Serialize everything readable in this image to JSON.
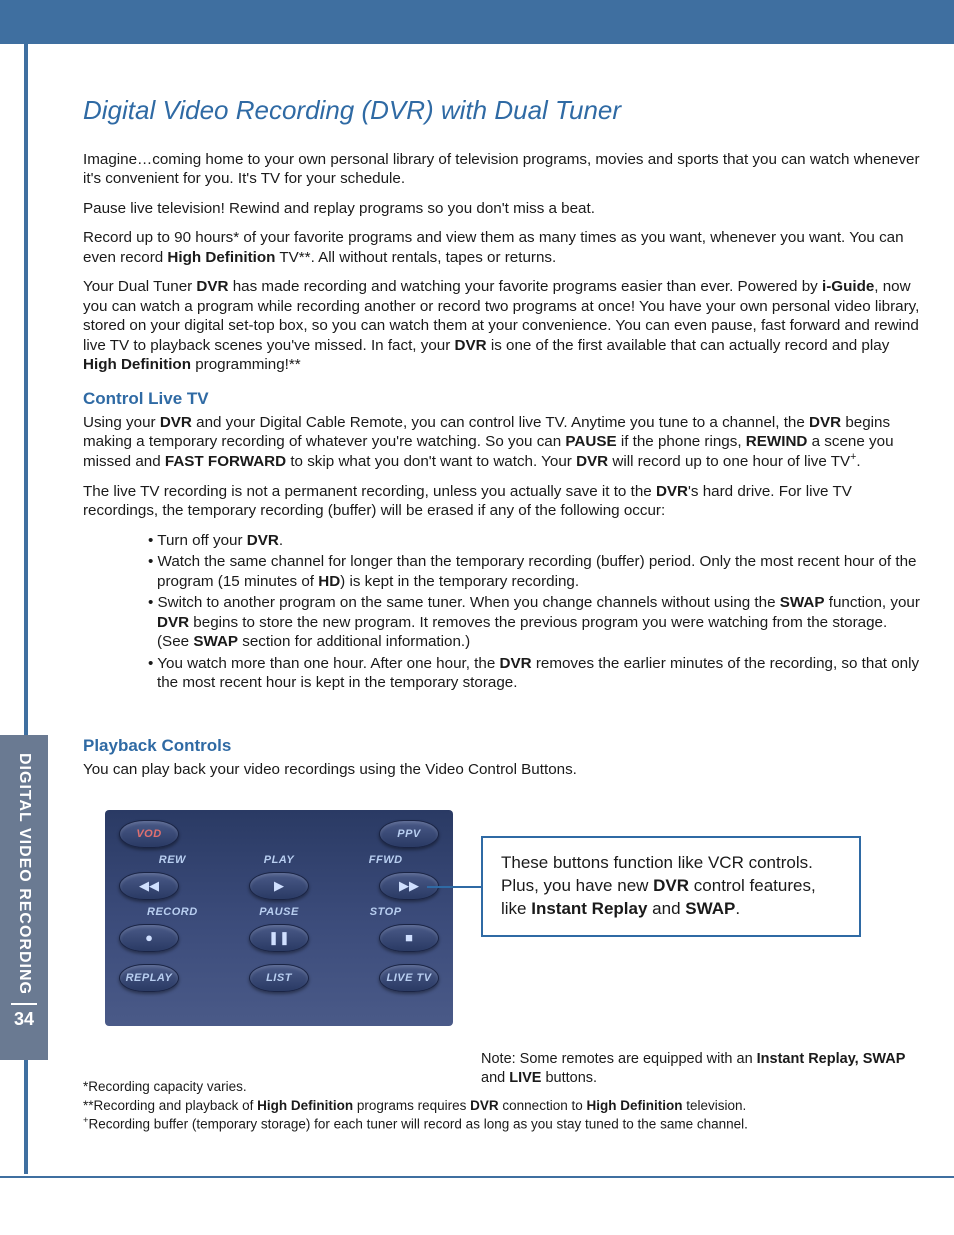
{
  "page": {
    "section_tab": "DIGITAL VIDEO RECORDING",
    "page_number": "34",
    "title": "Digital Video Recording (DVR) with Dual Tuner"
  },
  "intro": {
    "p1": "Imagine…coming home to your own personal library of television programs, movies and sports that you can watch whenever it's convenient for you. It's TV for your schedule.",
    "p2": "Pause live television! Rewind and replay programs so you don't miss a beat.",
    "p3a": "Record up to 90 hours* of your favorite programs and view them as many times as you want, whenever you want. You can even record ",
    "p3b": "High Definition",
    "p3c": " TV**. All without rentals, tapes or returns.",
    "p4a": "Your Dual Tuner ",
    "p4b": "DVR",
    "p4c": " has made recording and watching your favorite programs easier than ever. Powered by ",
    "p4d": "i-Guide",
    "p4e": ", now you can watch a program while recording another or record two programs at once!  You have your own personal video library, stored on your digital set-top box, so you can watch them at your convenience. You can even pause, fast forward and rewind live TV to playback scenes you've missed.  In fact, your ",
    "p4f": "DVR",
    "p4g": " is one of the first available that can actually record and play ",
    "p4h": "High Definition",
    "p4i": " programming!**"
  },
  "control": {
    "heading": "Control Live TV",
    "p1a": "Using your ",
    "p1b": "DVR",
    "p1c": " and your Digital Cable Remote, you can control live TV. Anytime you tune to a channel, the ",
    "p1d": "DVR",
    "p1e": " begins making a temporary recording of whatever you're watching. So you can ",
    "p1f": "PAUSE",
    "p1g": " if the phone rings, ",
    "p1h": "REWIND",
    "p1i": " a scene you missed and ",
    "p1j": "FAST FORWARD",
    "p1k": " to skip what you don't want to watch. Your ",
    "p1l": "DVR",
    "p1m": " will record up to one hour of live TV",
    "p1n": "+",
    "p1o": ".",
    "p2a": "The live TV recording is not a permanent recording, unless you actually save it to the ",
    "p2b": "DVR",
    "p2c": "'s hard drive. For live TV recordings, the temporary recording (buffer) will be erased if any of the following occur:"
  },
  "bullets": {
    "b1a": "Turn off your ",
    "b1b": "DVR",
    "b1c": ".",
    "b2a": "Watch the same channel for longer than the temporary recording (buffer) period.  Only the most recent hour of the program (15 minutes of ",
    "b2b": "HD",
    "b2c": ") is kept in the temporary recording.",
    "b3a": "Switch to another program on the same tuner.  When you change channels without using the ",
    "b3b": "SWAP",
    "b3c": " function, your ",
    "b3d": "DVR",
    "b3e": " begins to store the new program. It removes the previous program you were watching from the storage.  (See ",
    "b3f": "SWAP",
    "b3g": " section for additional information.)",
    "b4a": "You watch more than one hour.  After one hour, the ",
    "b4b": "DVR",
    "b4c": " removes the earlier minutes of the recording, so that only the most recent hour is kept in the temporary storage."
  },
  "playback": {
    "heading": "Playback Controls",
    "p1": "You can play back your video recordings using the Video Control Buttons."
  },
  "remote": {
    "labels": {
      "vod": "VOD",
      "ppv": "PPV",
      "rew": "REW",
      "play": "PLAY",
      "ffwd": "FFWD",
      "record": "RECORD",
      "pause": "PAUSE",
      "stop": "STOP",
      "replay": "REPLAY",
      "list": "LIST",
      "livetv": "LIVE TV"
    },
    "icons": {
      "rew": "◀◀",
      "play": "▶",
      "ffwd": "▶▶",
      "record": "●",
      "pause": "❚❚",
      "stop": "■"
    }
  },
  "callout": {
    "t1": "These buttons function like  VCR controls. Plus, you have new ",
    "t2": "DVR",
    "t3": " control features, like ",
    "t4": "Instant Replay",
    "t5": " and ",
    "t6": "SWAP",
    "t7": "."
  },
  "note": {
    "t1": "Note: Some remotes are equipped with an ",
    "t2": "Instant Replay, SWAP",
    "t3": " and ",
    "t4": "LIVE",
    "t5": " buttons."
  },
  "footnotes": {
    "f1": "*Recording capacity varies.",
    "f2a": "**Recording and playback of ",
    "f2b": "High Definition",
    "f2c": " programs requires ",
    "f2d": "DVR",
    "f2e": " connection to ",
    "f2f": "High Definition",
    "f2g": " television.",
    "f3a": "+",
    "f3b": "Recording buffer (temporary storage) for each tuner will record as long as you stay tuned to the same channel."
  }
}
